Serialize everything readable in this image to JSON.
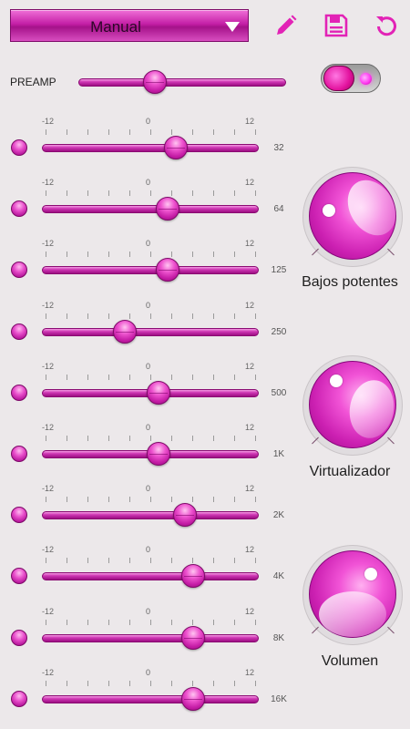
{
  "header": {
    "preset_label": "Manual",
    "icons": [
      "pencil-icon",
      "save-icon",
      "reset-icon"
    ]
  },
  "preamp": {
    "label": "PREAMP",
    "value_fraction": 0.36,
    "enabled": true
  },
  "scale": {
    "min": "-12",
    "mid": "0",
    "max": "12"
  },
  "bands": [
    {
      "label": "32",
      "value": 3
    },
    {
      "label": "64",
      "value": 2
    },
    {
      "label": "125",
      "value": 2
    },
    {
      "label": "250",
      "value": -3
    },
    {
      "label": "500",
      "value": 1
    },
    {
      "label": "1K",
      "value": 1
    },
    {
      "label": "2K",
      "value": 4
    },
    {
      "label": "4K",
      "value": 5
    },
    {
      "label": "8K",
      "value": 5
    },
    {
      "label": "16K",
      "value": 5
    }
  ],
  "knobs": [
    {
      "label": "Bajos potentes"
    },
    {
      "label": "Virtualizador"
    },
    {
      "label": "Volumen"
    }
  ],
  "colors": {
    "accent": "#d62cb8",
    "background": "#ece8ea"
  }
}
